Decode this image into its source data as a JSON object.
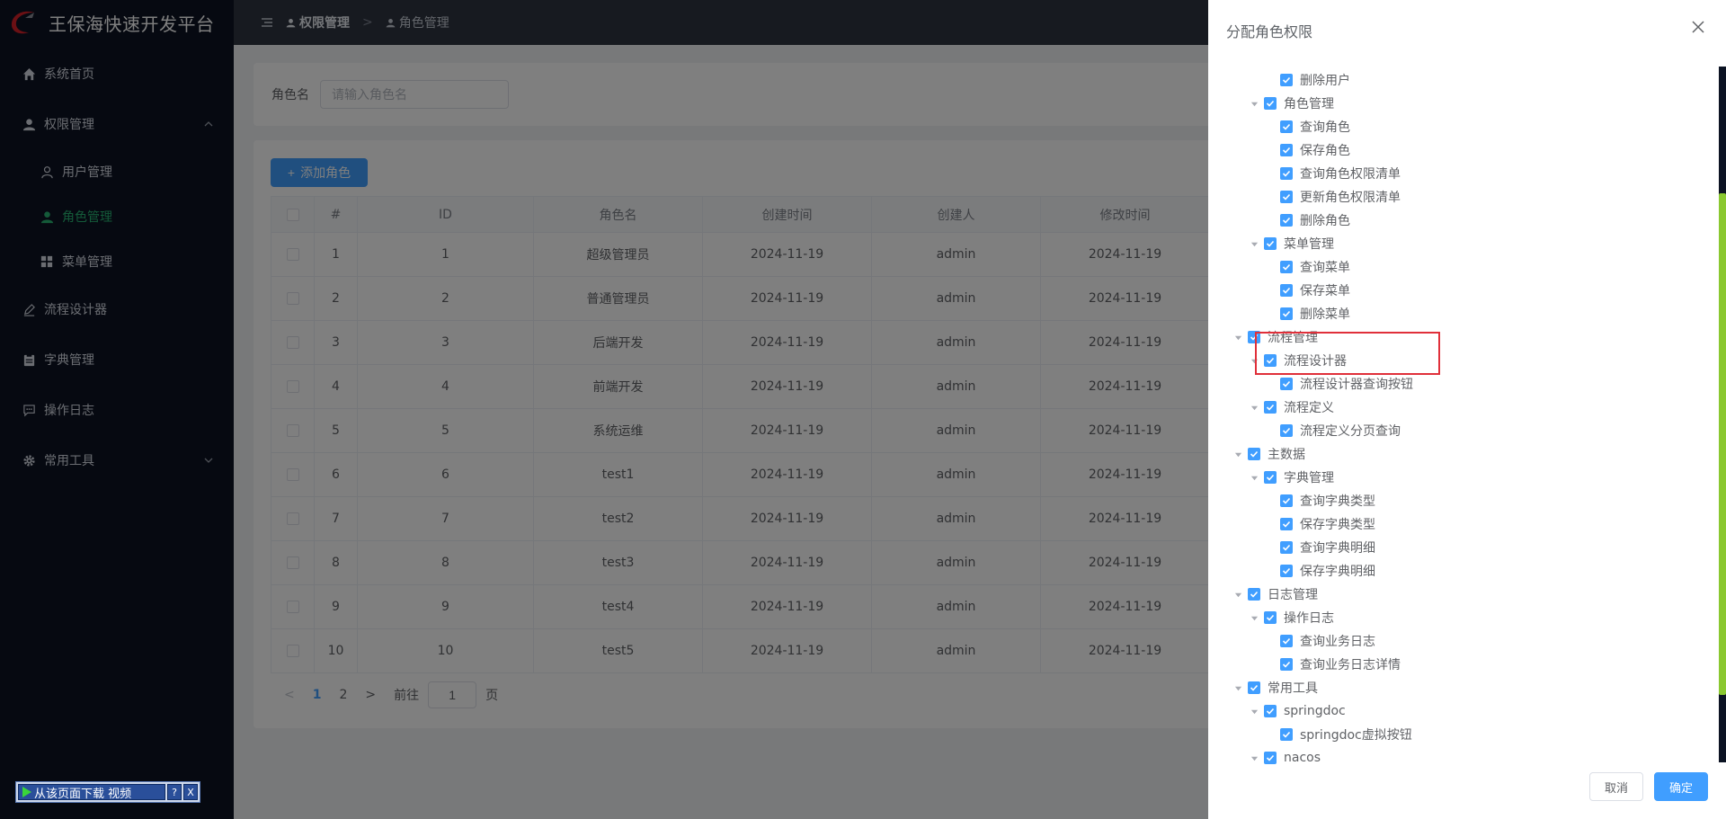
{
  "app": {
    "title": "王保海快速开发平台"
  },
  "sidebar": {
    "items": [
      {
        "label": "系统首页"
      },
      {
        "label": "权限管理"
      },
      {
        "label": "用户管理"
      },
      {
        "label": "角色管理"
      },
      {
        "label": "菜单管理"
      },
      {
        "label": "流程设计器"
      },
      {
        "label": "字典管理"
      },
      {
        "label": "操作日志"
      },
      {
        "label": "常用工具"
      }
    ]
  },
  "header": {
    "crumb1": "权限管理",
    "crumb2": "角色管理"
  },
  "search": {
    "label": "角色名",
    "placeholder": "请输入角色名"
  },
  "toolbar": {
    "add_label": "添加角色"
  },
  "table": {
    "columns": [
      "#",
      "ID",
      "角色名",
      "创建时间",
      "创建人",
      "修改时间"
    ],
    "rows": [
      [
        "1",
        "1",
        "超级管理员",
        "2024-11-19",
        "admin",
        "2024-11-19"
      ],
      [
        "2",
        "2",
        "普通管理员",
        "2024-11-19",
        "admin",
        "2024-11-19"
      ],
      [
        "3",
        "3",
        "后端开发",
        "2024-11-19",
        "admin",
        "2024-11-19"
      ],
      [
        "4",
        "4",
        "前端开发",
        "2024-11-19",
        "admin",
        "2024-11-19"
      ],
      [
        "5",
        "5",
        "系统运维",
        "2024-11-19",
        "admin",
        "2024-11-19"
      ],
      [
        "6",
        "6",
        "test1",
        "2024-11-19",
        "admin",
        "2024-11-19"
      ],
      [
        "7",
        "7",
        "test2",
        "2024-11-19",
        "admin",
        "2024-11-19"
      ],
      [
        "8",
        "8",
        "test3",
        "2024-11-19",
        "admin",
        "2024-11-19"
      ],
      [
        "9",
        "9",
        "test4",
        "2024-11-19",
        "admin",
        "2024-11-19"
      ],
      [
        "10",
        "10",
        "test5",
        "2024-11-19",
        "admin",
        "2024-11-19"
      ]
    ]
  },
  "pager": {
    "pages": [
      "1",
      "2"
    ],
    "goto_label": "前往",
    "goto_value": "1",
    "page_suffix": "页"
  },
  "float_bar": {
    "download_label": "从该页面下载 视频",
    "help": "?",
    "close": "X"
  },
  "drawer": {
    "title": "分配角色权限",
    "cancel": "取消",
    "ok": "确定",
    "tree": [
      {
        "label": "删除用户",
        "level": 2,
        "expanded": false
      },
      {
        "label": "角色管理",
        "level": 1,
        "expanded": true
      },
      {
        "label": "查询角色",
        "level": 2,
        "expanded": false
      },
      {
        "label": "保存角色",
        "level": 2,
        "expanded": false
      },
      {
        "label": "查询角色权限清单",
        "level": 2,
        "expanded": false
      },
      {
        "label": "更新角色权限清单",
        "level": 2,
        "expanded": false
      },
      {
        "label": "删除角色",
        "level": 2,
        "expanded": false
      },
      {
        "label": "菜单管理",
        "level": 1,
        "expanded": true
      },
      {
        "label": "查询菜单",
        "level": 2,
        "expanded": false
      },
      {
        "label": "保存菜单",
        "level": 2,
        "expanded": false
      },
      {
        "label": "删除菜单",
        "level": 2,
        "expanded": false
      },
      {
        "label": "流程管理",
        "level": 0,
        "expanded": true
      },
      {
        "label": "流程设计器",
        "level": 1,
        "expanded": true
      },
      {
        "label": "流程设计器查询按钮",
        "level": 2,
        "expanded": false
      },
      {
        "label": "流程定义",
        "level": 1,
        "expanded": true
      },
      {
        "label": "流程定义分页查询",
        "level": 2,
        "expanded": false
      },
      {
        "label": "主数据",
        "level": 0,
        "expanded": true
      },
      {
        "label": "字典管理",
        "level": 1,
        "expanded": true
      },
      {
        "label": "查询字典类型",
        "level": 2,
        "expanded": false
      },
      {
        "label": "保存字典类型",
        "level": 2,
        "expanded": false
      },
      {
        "label": "查询字典明细",
        "level": 2,
        "expanded": false
      },
      {
        "label": "保存字典明细",
        "level": 2,
        "expanded": false
      },
      {
        "label": "日志管理",
        "level": 0,
        "expanded": true
      },
      {
        "label": "操作日志",
        "level": 1,
        "expanded": true
      },
      {
        "label": "查询业务日志",
        "level": 2,
        "expanded": false
      },
      {
        "label": "查询业务日志详情",
        "level": 2,
        "expanded": false
      },
      {
        "label": "常用工具",
        "level": 0,
        "expanded": true
      },
      {
        "label": "springdoc",
        "level": 1,
        "expanded": true
      },
      {
        "label": "springdoc虚拟按钮",
        "level": 2,
        "expanded": false
      },
      {
        "label": "nacos",
        "level": 1,
        "expanded": true
      }
    ]
  },
  "colors": {
    "accent": "#409eff",
    "active_menu": "#29b473",
    "sidebar_bg": "#0c1323",
    "highlight": "#e0303a"
  }
}
